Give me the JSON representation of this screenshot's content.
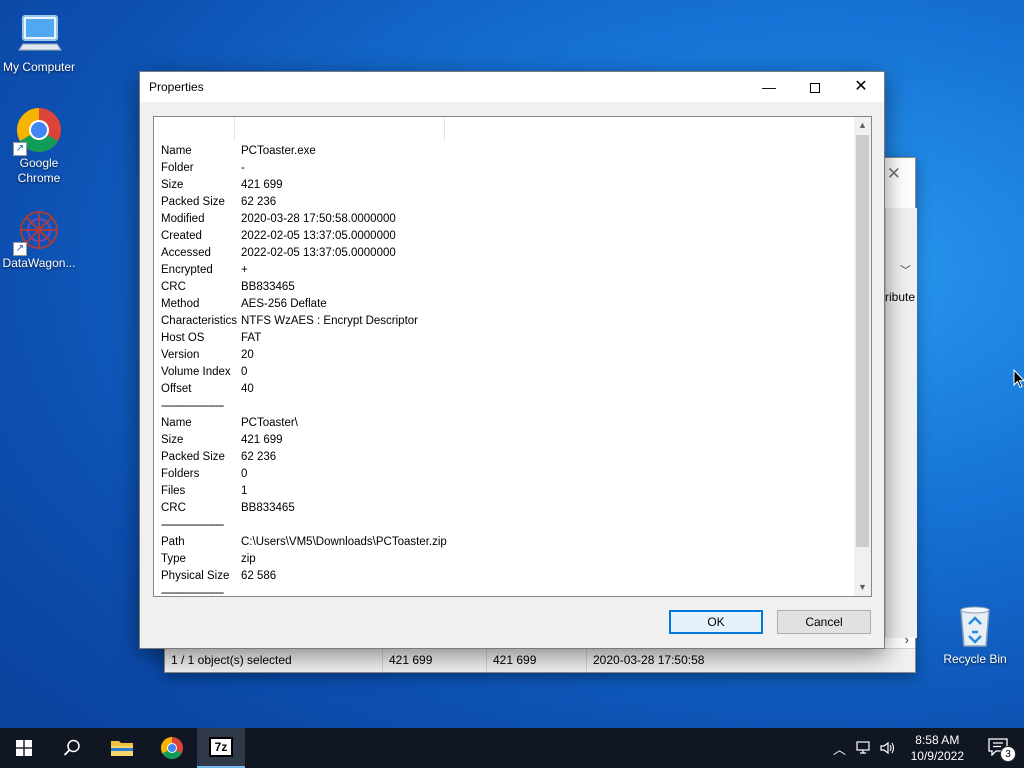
{
  "desktop": {
    "icons": [
      {
        "label": "My Computer"
      },
      {
        "label": "Google Chrome"
      },
      {
        "label": "DataWagon..."
      },
      {
        "label": "Recycle Bin"
      }
    ]
  },
  "background_window": {
    "column_fragment": "ribute",
    "status": {
      "selected": "1 / 1 object(s) selected",
      "size": "421 699",
      "packed": "421 699",
      "modified": "2020-03-28 17:50:58"
    }
  },
  "dialog": {
    "title": "Properties",
    "rows": [
      {
        "k": "Name",
        "v": "PCToaster.exe"
      },
      {
        "k": "Folder",
        "v": "-"
      },
      {
        "k": "Size",
        "v": "421 699"
      },
      {
        "k": "Packed Size",
        "v": "62 236"
      },
      {
        "k": "Modified",
        "v": "2020-03-28 17:50:58.0000000"
      },
      {
        "k": "Created",
        "v": "2022-02-05 13:37:05.0000000"
      },
      {
        "k": "Accessed",
        "v": "2022-02-05 13:37:05.0000000"
      },
      {
        "k": "Encrypted",
        "v": "+"
      },
      {
        "k": "CRC",
        "v": "BB833465"
      },
      {
        "k": "Method",
        "v": "AES-256 Deflate"
      },
      {
        "k": "Characteristics",
        "v": "NTFS WzAES : Encrypt Descriptor"
      },
      {
        "k": "Host OS",
        "v": "FAT"
      },
      {
        "k": "Version",
        "v": "20"
      },
      {
        "k": "Volume Index",
        "v": "0"
      },
      {
        "k": "Offset",
        "v": "40"
      },
      {
        "k": "----------------------",
        "v": ""
      },
      {
        "k": "Name",
        "v": "PCToaster\\"
      },
      {
        "k": "Size",
        "v": "421 699"
      },
      {
        "k": "Packed Size",
        "v": "62 236"
      },
      {
        "k": "Folders",
        "v": "0"
      },
      {
        "k": "Files",
        "v": "1"
      },
      {
        "k": "CRC",
        "v": "BB833465"
      },
      {
        "k": "----------------------",
        "v": ""
      },
      {
        "k": "Path",
        "v": "C:\\Users\\VM5\\Downloads\\PCToaster.zip"
      },
      {
        "k": "Type",
        "v": "zip"
      },
      {
        "k": "Physical Size",
        "v": "62 586"
      },
      {
        "k": "----------------------",
        "v": ""
      }
    ],
    "ok_label": "OK",
    "cancel_label": "Cancel"
  },
  "taskbar": {
    "items": [
      "windows-start-icon",
      "search-icon",
      "file-explorer-icon",
      "chrome-icon",
      "7zip-icon"
    ],
    "time": "8:58 AM",
    "date": "10/9/2022",
    "zip_label": "7z",
    "notification_count": "3"
  }
}
